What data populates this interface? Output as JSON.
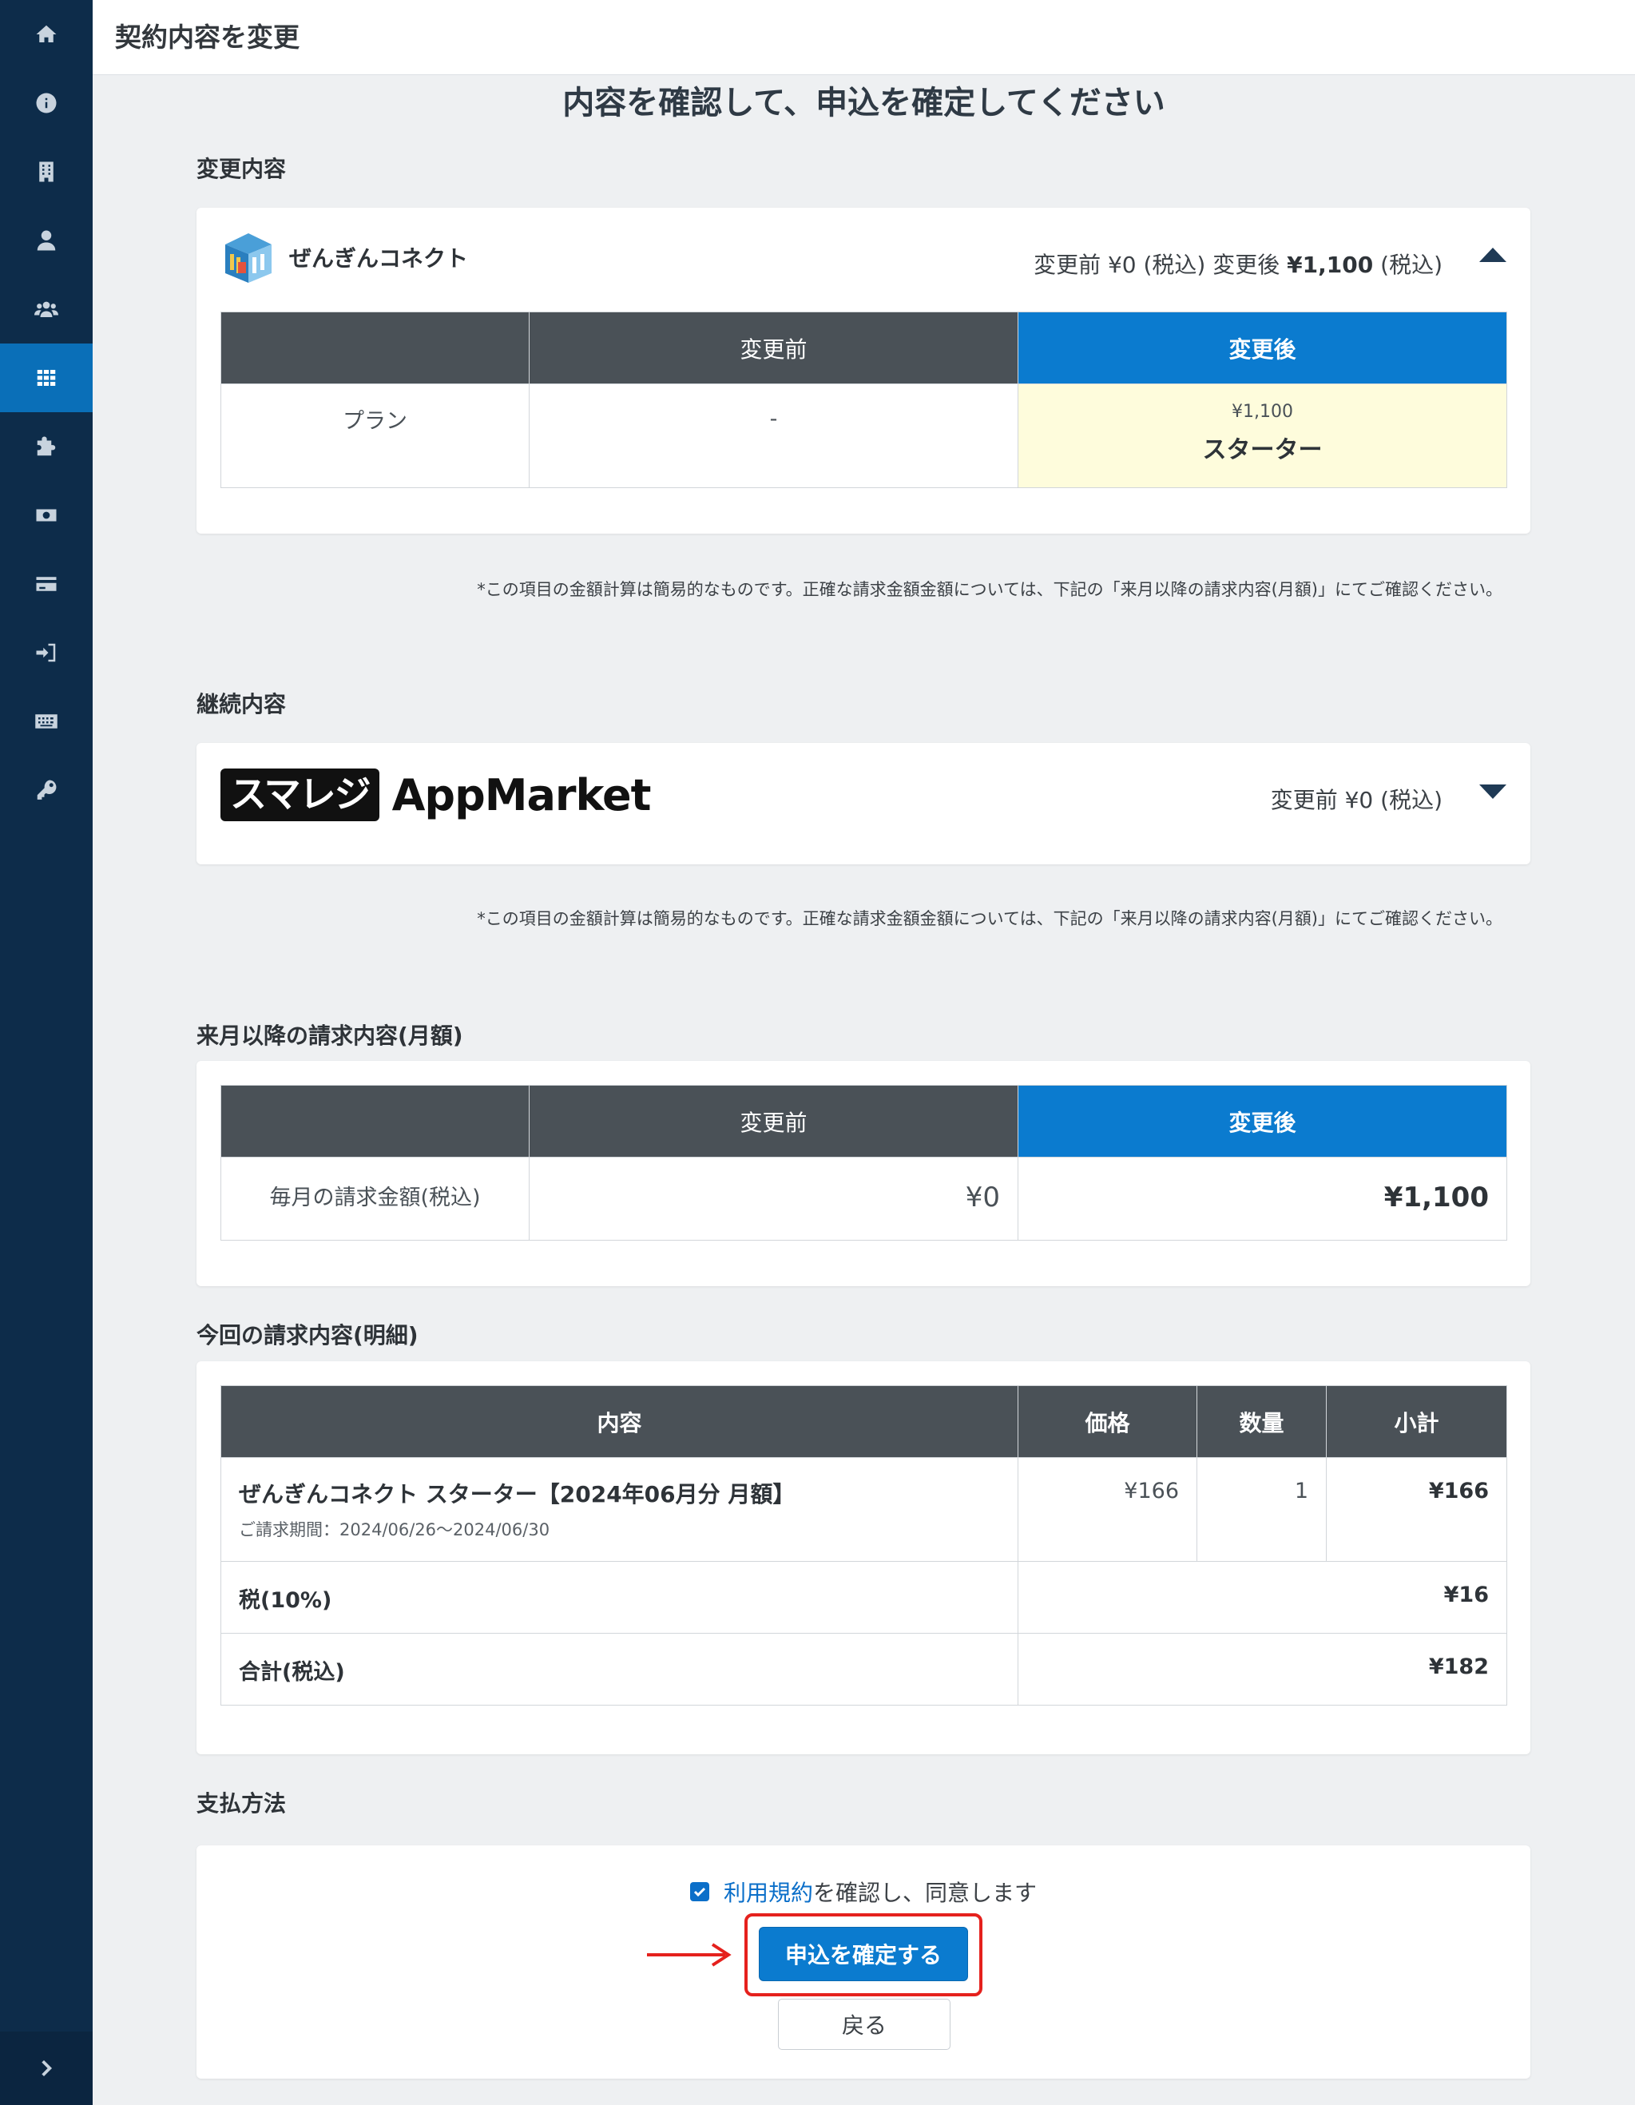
{
  "header": {
    "title": "契約内容を変更"
  },
  "main_title": "内容を確認して、申込を確定してください",
  "sidebar": {
    "items": [
      {
        "icon": "home-icon"
      },
      {
        "icon": "info-icon"
      },
      {
        "icon": "building-icon"
      },
      {
        "icon": "user-icon"
      },
      {
        "icon": "users-icon"
      },
      {
        "icon": "grid-icon",
        "active": true
      },
      {
        "icon": "puzzle-icon"
      },
      {
        "icon": "money-icon"
      },
      {
        "icon": "credit-card-icon"
      },
      {
        "icon": "sign-in-icon"
      },
      {
        "icon": "keyboard-icon"
      },
      {
        "icon": "key-icon"
      }
    ],
    "expand_icon": "chevron-right-icon"
  },
  "change_section": {
    "heading": "変更内容",
    "app_name": "ぜんぎんコネクト",
    "price_before_label": "変更前 ¥0 (税込) 変更後",
    "price_after_value": "¥1,100",
    "price_after_suffix": "(税込)",
    "table": {
      "headers": [
        "",
        "変更前",
        "変更後"
      ],
      "row_label": "プラン",
      "before": "-",
      "after_price": "¥1,100",
      "after_plan": "スターター"
    },
    "note": "*この項目の金額計算は簡易的なものです。正確な請求金額金額については、下記の「来月以降の請求内容(月額)」にてご確認ください。"
  },
  "continue_section": {
    "heading": "継続内容",
    "logo_box": "スマレジ",
    "logo_text": "AppMarket",
    "price": "変更前 ¥0 (税込)",
    "note": "*この項目の金額計算は簡易的なものです。正確な請求金額金額については、下記の「来月以降の請求内容(月額)」にてご確認ください。"
  },
  "monthly_section": {
    "heading": "来月以降の請求内容(月額)",
    "headers": [
      "",
      "変更前",
      "変更後"
    ],
    "row_label": "毎月の請求金額(税込)",
    "before": "¥0",
    "after": "¥1,100"
  },
  "detail_section": {
    "heading": "今回の請求内容(明細)",
    "headers": [
      "内容",
      "価格",
      "数量",
      "小計"
    ],
    "item_name": "ぜんぎんコネクト スターター【2024年06月分 月額】",
    "item_period": "ご請求期間：2024/06/26〜2024/06/30",
    "item_price": "¥166",
    "item_qty": "1",
    "item_subtotal": "¥166",
    "tax_label": "税(10%)",
    "tax_value": "¥16",
    "total_label": "合計(税込)",
    "total_value": "¥182"
  },
  "payment_section": {
    "heading": "支払方法",
    "agree_link": "利用規約",
    "agree_text": "を確認し、同意します",
    "agree_checked": true,
    "confirm_label": "申込を確定する",
    "back_label": "戻る"
  },
  "colors": {
    "sidebar": "#0d2c4a",
    "accent": "#0b7bcf",
    "highlight": "#e5211d"
  }
}
